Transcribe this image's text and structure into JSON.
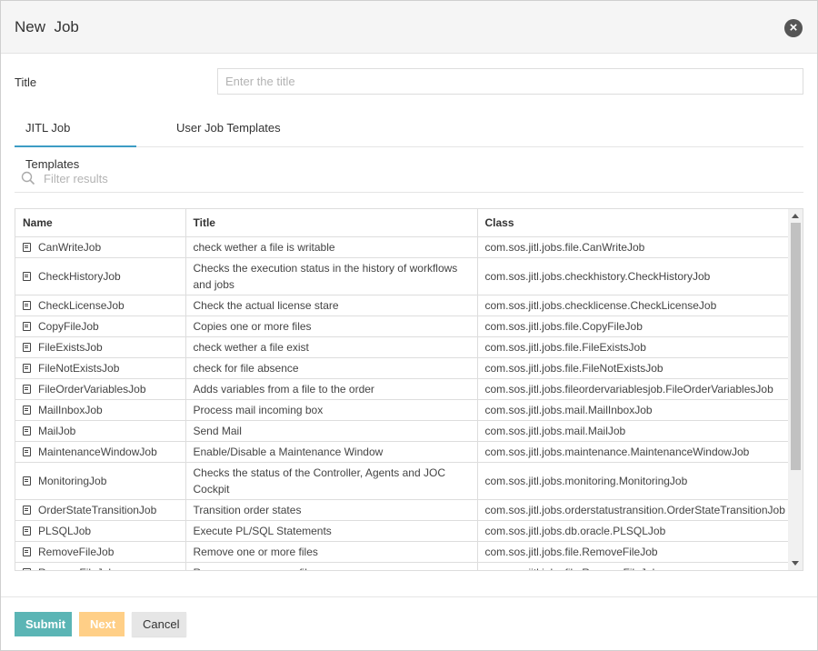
{
  "dialog": {
    "title": "New  Job",
    "close_icon": "times-circle-icon"
  },
  "form": {
    "title_label": "Title",
    "title_placeholder": "Enter the title",
    "title_value": ""
  },
  "tabs": [
    {
      "label": "JITL Job Templates",
      "active": true
    },
    {
      "label": "User Job Templates",
      "active": false
    }
  ],
  "filter": {
    "placeholder": "Filter results",
    "icon": "search-icon"
  },
  "table": {
    "columns": [
      "Name",
      "Title",
      "Class"
    ],
    "rows": [
      {
        "name": "CanWriteJob",
        "title": "check wether a file is writable",
        "class": "com.sos.jitl.jobs.file.CanWriteJob"
      },
      {
        "name": "CheckHistoryJob",
        "title": "Checks the execution status in the history of workflows and jobs",
        "class": "com.sos.jitl.jobs.checkhistory.CheckHistoryJob"
      },
      {
        "name": "CheckLicenseJob",
        "title": "Check the actual license stare",
        "class": "com.sos.jitl.jobs.checklicense.CheckLicenseJob"
      },
      {
        "name": "CopyFileJob",
        "title": "Copies one or more files",
        "class": "com.sos.jitl.jobs.file.CopyFileJob"
      },
      {
        "name": "FileExistsJob",
        "title": "check wether a file exist",
        "class": "com.sos.jitl.jobs.file.FileExistsJob"
      },
      {
        "name": "FileNotExistsJob",
        "title": "check for file absence",
        "class": "com.sos.jitl.jobs.file.FileNotExistsJob"
      },
      {
        "name": "FileOrderVariablesJob",
        "title": "Adds variables from a file to the order",
        "class": "com.sos.jitl.jobs.fileordervariablesjob.FileOrderVariablesJob"
      },
      {
        "name": "MailInboxJob",
        "title": "Process mail incoming box",
        "class": "com.sos.jitl.jobs.mail.MailInboxJob"
      },
      {
        "name": "MailJob",
        "title": "Send Mail",
        "class": "com.sos.jitl.jobs.mail.MailJob"
      },
      {
        "name": "MaintenanceWindowJob",
        "title": "Enable/Disable a Maintenance Window",
        "class": "com.sos.jitl.jobs.maintenance.MaintenanceWindowJob"
      },
      {
        "name": "MonitoringJob",
        "title": "Checks the status of the Controller, Agents and JOC Cockpit",
        "class": "com.sos.jitl.jobs.monitoring.MonitoringJob"
      },
      {
        "name": "OrderStateTransitionJob",
        "title": "Transition order states",
        "class": "com.sos.jitl.jobs.orderstatustransition.OrderStateTransitionJob"
      },
      {
        "name": "PLSQLJob",
        "title": "Execute PL/SQL Statements",
        "class": "com.sos.jitl.jobs.db.oracle.PLSQLJob"
      },
      {
        "name": "RemoveFileJob",
        "title": "Remove one or more files",
        "class": "com.sos.jitl.jobs.file.RemoveFileJob"
      },
      {
        "name": "RenameFileJob",
        "title": "Rename one or more files",
        "class": "com.sos.jitl.jobs.file.RenameFileJob"
      }
    ]
  },
  "footer": {
    "submit_label": "Submit",
    "next_label": "Next",
    "cancel_label": "Cancel"
  },
  "colors": {
    "submit": "#5bb5b5",
    "next": "#ffcf87",
    "active_tab": "#3d9cc4"
  }
}
